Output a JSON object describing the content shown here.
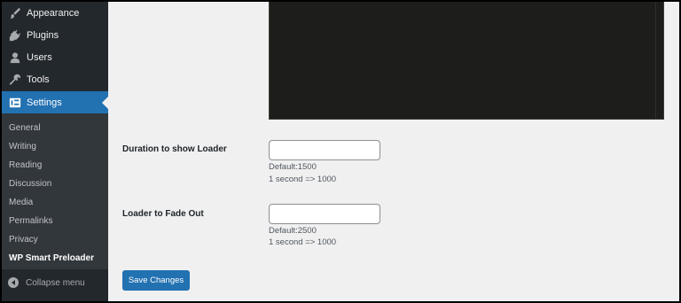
{
  "sidebar": {
    "menu": [
      {
        "label": "Appearance",
        "icon": "paintbrush-icon"
      },
      {
        "label": "Plugins",
        "icon": "plug-icon"
      },
      {
        "label": "Users",
        "icon": "user-icon"
      },
      {
        "label": "Tools",
        "icon": "wrench-icon"
      },
      {
        "label": "Settings",
        "icon": "settings-icon",
        "active": true
      }
    ],
    "submenu": [
      {
        "label": "General"
      },
      {
        "label": "Writing"
      },
      {
        "label": "Reading"
      },
      {
        "label": "Discussion"
      },
      {
        "label": "Media"
      },
      {
        "label": "Permalinks"
      },
      {
        "label": "Privacy"
      },
      {
        "label": "WP Smart Preloader",
        "current": true
      }
    ],
    "collapse_label": "Collapse menu"
  },
  "form": {
    "duration": {
      "label": "Duration to show Loader",
      "value": "",
      "hint_default": "Default:1500",
      "hint_unit": "1 second => 1000"
    },
    "fade": {
      "label": "Loader to Fade Out",
      "value": "",
      "hint_default": "Default:2500",
      "hint_unit": "1 second => 1000"
    },
    "save_label": "Save Changes"
  },
  "colors": {
    "sidebar_bg": "#23282d",
    "submenu_bg": "#32373c",
    "accent": "#2271b1",
    "content_bg": "#f0f0f1",
    "preview_bg": "#1d1d1b"
  }
}
